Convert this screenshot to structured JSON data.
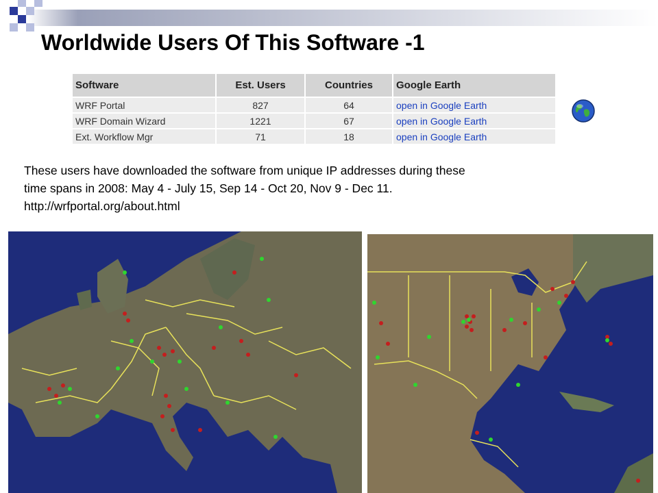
{
  "slide": {
    "title": "Worldwide Users Of This Software -1"
  },
  "table": {
    "headers": [
      "Software",
      "Est. Users",
      "Countries",
      "Google Earth"
    ],
    "rows": [
      {
        "software": "WRF Portal",
        "users": "827",
        "countries": "64",
        "link": "open in Google Earth"
      },
      {
        "software": "WRF Domain Wizard",
        "users": "1221",
        "countries": "67",
        "link": "open in Google Earth"
      },
      {
        "software": "Ext. Workflow Mgr",
        "users": "71",
        "countries": "18",
        "link": "open in Google Earth"
      }
    ]
  },
  "description": {
    "line1": "These users have downloaded the software from unique IP addresses during these",
    "line2": "time spans in 2008: May 4 - July 15, Sep 14 - Oct 20, Nov 9 - Dec 11.",
    "url": "http://wrfportal.org/about.html"
  },
  "icons": {
    "globe": "google-earth-globe-icon"
  },
  "colors": {
    "deco_blue": "#2b3a9a",
    "deco_light": "#b7bedf",
    "header_bg": "#d4d4d4",
    "row_bg": "#ececec",
    "link": "#1a3fbf",
    "ocean": "#1e2c7a",
    "border_yellow": "#e8e25a",
    "marker_red": "#c41e1e",
    "marker_green": "#2fd62f"
  }
}
